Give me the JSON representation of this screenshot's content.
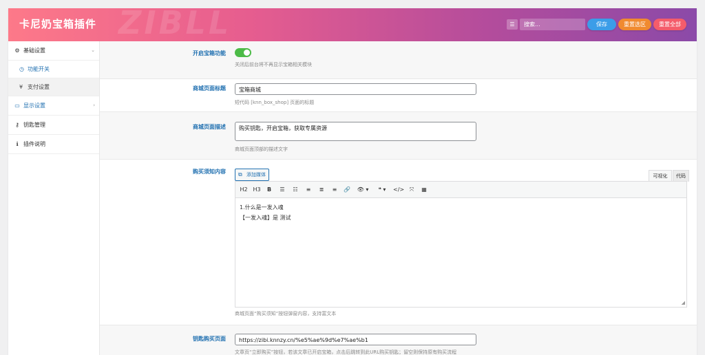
{
  "header": {
    "title": "卡尼奶宝箱插件",
    "watermark": "ZIBLL",
    "search_placeholder": "搜索...",
    "save_label": "保存",
    "reset_section_label": "重置选区",
    "reset_all_label": "重置全部",
    "colors": {
      "save": "#3b9de8",
      "reset_section": "#f08a30",
      "reset_all": "#f45c6b"
    }
  },
  "sidebar": {
    "items": [
      {
        "label": "基础设置",
        "icon": "gear-icon",
        "glyph": "⚙",
        "arrow": "⌄"
      },
      {
        "label": "功能开关",
        "icon": "clock-icon",
        "glyph": "◷"
      },
      {
        "label": "支付设置",
        "icon": "yen-icon",
        "glyph": "¥"
      },
      {
        "label": "显示设置",
        "icon": "monitor-icon",
        "glyph": "▭",
        "arrow": "›"
      },
      {
        "label": "钥匙管理",
        "icon": "key-icon",
        "glyph": "⚷"
      },
      {
        "label": "插件说明",
        "icon": "info-icon",
        "glyph": "ℹ"
      }
    ]
  },
  "fields": {
    "toggle": {
      "label": "开启宝箱功能",
      "desc": "关闭后前台将不再显示宝箱相关模块",
      "on": true
    },
    "shop_title": {
      "label": "商城页面标题",
      "value": "宝箱商城",
      "desc": "短代码 [knn_box_shop] 页面的标题"
    },
    "shop_desc": {
      "label": "商城页面描述",
      "value": "购买钥匙，开启宝箱，获取专属资源",
      "desc": "商城页面顶部的描述文字"
    },
    "notice": {
      "label": "购买须知内容",
      "media_button": "添加媒体",
      "tab_visual": "可视化",
      "tab_code": "代码",
      "toolbar": [
        "H2",
        "H3",
        "B",
        "☰",
        "☷",
        "≡",
        "≣",
        "≡",
        "🔗",
        "👁 ▾",
        "❝ ▾",
        "</>",
        "⤧",
        "▦"
      ],
      "lines": [
        "1.什么是一发入魂",
        "【一发入魂】是 测试"
      ],
      "desc": "商城页面“购买须知”按钮弹窗内容，支持富文本"
    },
    "key_url": {
      "label": "钥匙购买页面",
      "value": "https://zibi.knnzy.cn/%e5%ae%9d%e7%ae%b1",
      "desc": "文章页“立即购买”按钮，若该文章已开启宝箱，点击后跳转到此URL购买钥匙；留空则保持原有购买流程"
    }
  }
}
